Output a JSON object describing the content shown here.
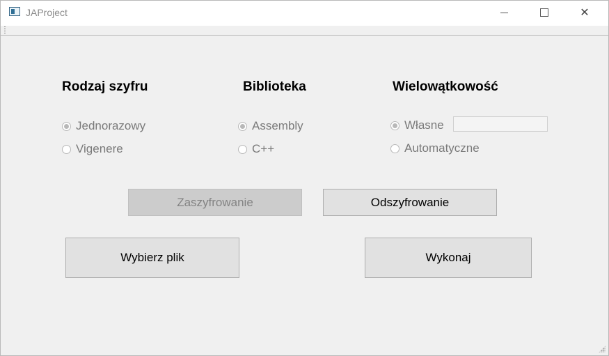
{
  "window": {
    "title": "JAProject",
    "close_glyph": "✕"
  },
  "groups": {
    "cipher": {
      "title": "Rodzaj szyfru",
      "options": [
        {
          "label": "Jednorazowy",
          "checked": true
        },
        {
          "label": "Vigenere",
          "checked": false
        }
      ]
    },
    "library": {
      "title": "Biblioteka",
      "options": [
        {
          "label": "Assembly",
          "checked": true
        },
        {
          "label": "C++",
          "checked": false
        }
      ]
    },
    "threading": {
      "title": "Wielowątkowość",
      "options": [
        {
          "label": "Własne",
          "checked": true
        },
        {
          "label": "Automatyczne",
          "checked": false
        }
      ],
      "thread_count_value": ""
    }
  },
  "buttons": {
    "encrypt": "Zaszyfrowanie",
    "decrypt": "Odszyfrowanie",
    "choose_file": "Wybierz plik",
    "execute": "Wykonaj"
  }
}
